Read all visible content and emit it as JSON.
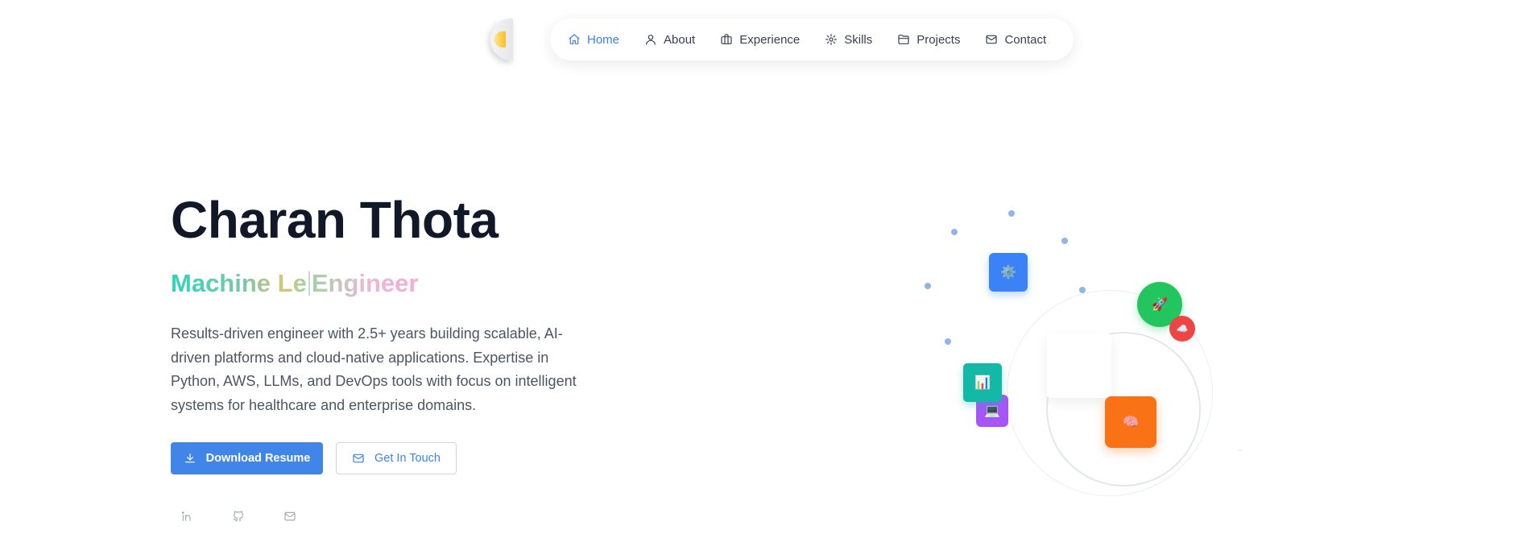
{
  "nav": {
    "items": [
      {
        "label": "Home",
        "icon": "home-icon",
        "active": true
      },
      {
        "label": "About",
        "icon": "user-icon",
        "active": false
      },
      {
        "label": "Experience",
        "icon": "briefcase-icon",
        "active": false
      },
      {
        "label": "Skills",
        "icon": "gear-icon",
        "active": false
      },
      {
        "label": "Projects",
        "icon": "folder-icon",
        "active": false
      },
      {
        "label": "Contact",
        "icon": "mail-icon",
        "active": false
      }
    ],
    "active_color": "#3b82f6"
  },
  "theme_toggle": {
    "icon": "sun-icon"
  },
  "hero": {
    "name": "Charan Thota",
    "role_typed_a": "Machine Le",
    "role_typed_b": "Engineer",
    "description": "Results-driven engineer with 2.5+ years building scalable, AI-driven platforms and cloud-native applications. Expertise in Python, AWS, LLMs, and DevOps tools with focus on intelligent systems for healthcare and enterprise domains.",
    "primary_button": {
      "label": "Download Resume",
      "icon": "download-icon",
      "color": "#4285e8"
    },
    "secondary_button": {
      "label": "Get In Touch",
      "icon": "mail-icon"
    },
    "socials": [
      {
        "icon": "linkedin-icon"
      },
      {
        "icon": "github-icon"
      },
      {
        "icon": "mail-icon"
      }
    ]
  },
  "illustration": {
    "tiles": [
      {
        "name": "settings-tile",
        "icon": "gear-emoji-icon",
        "color": "#3b82f6"
      },
      {
        "name": "chart-tile",
        "icon": "bar-chart-emoji-icon",
        "color": "#14b8a6"
      },
      {
        "name": "laptop-tile",
        "icon": "laptop-emoji-icon",
        "color": "#a855f7"
      },
      {
        "name": "brain-tile",
        "icon": "brain-emoji-icon",
        "color": "#f97316"
      },
      {
        "name": "rocket-tile",
        "icon": "rocket-emoji-icon",
        "color": "#22c55e"
      },
      {
        "name": "cloud-tile",
        "icon": "cloud-emoji-icon",
        "color": "#ef4444"
      }
    ]
  }
}
